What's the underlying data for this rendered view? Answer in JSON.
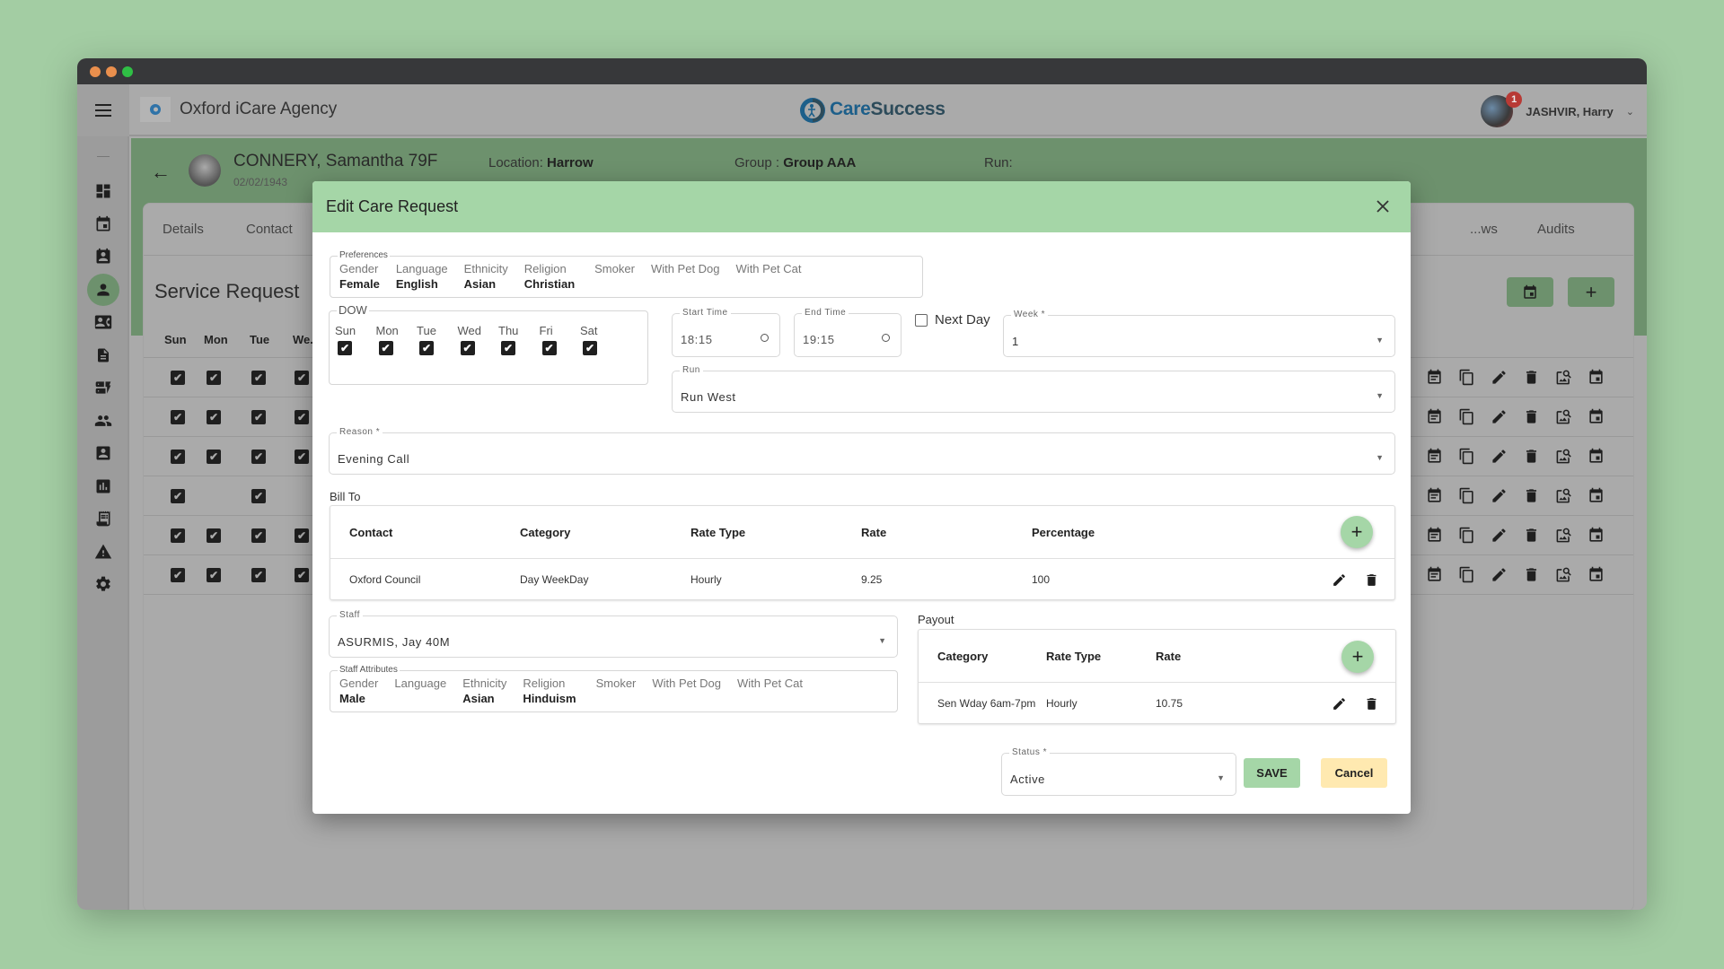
{
  "window": {
    "traffic_lights": [
      "close",
      "minimize",
      "maximize"
    ]
  },
  "header": {
    "agency_name": "Oxford iCare Agency",
    "brand_care": "Care",
    "brand_success": "Success",
    "user_name": "JASHVIR, Harry",
    "notification_count": "1"
  },
  "sidebar": {
    "items": [
      {
        "icon": "dashboard-icon"
      },
      {
        "icon": "calendar-icon"
      },
      {
        "icon": "calendar-person-icon"
      },
      {
        "icon": "person-icon",
        "active": true
      },
      {
        "icon": "contact-card-icon"
      },
      {
        "icon": "document-icon"
      },
      {
        "icon": "dynamic-form-icon"
      },
      {
        "icon": "people-icon"
      },
      {
        "icon": "account-box-icon"
      },
      {
        "icon": "chart-icon"
      },
      {
        "icon": "receipt-icon"
      },
      {
        "icon": "warning-icon"
      },
      {
        "icon": "settings-icon"
      }
    ]
  },
  "patient": {
    "name": "CONNERY, Samantha 79F",
    "dob": "02/02/1943",
    "location_label": "Location: ",
    "location": "Harrow",
    "group_label": "Group : ",
    "group": "Group AAA",
    "run_label": "Run:"
  },
  "background": {
    "tabs": [
      "Details",
      "Contact",
      "...ws",
      "Audits"
    ],
    "title": "Service Request",
    "columns": [
      "Sun",
      "Mon",
      "Tue",
      "We..."
    ],
    "rows": [
      [
        true,
        true,
        true,
        true
      ],
      [
        true,
        true,
        true,
        true
      ],
      [
        true,
        true,
        true,
        true
      ],
      [
        true,
        false,
        true,
        false
      ],
      [
        true,
        true,
        true,
        true
      ],
      [
        true,
        true,
        true,
        true
      ]
    ],
    "row_actions": [
      "event-note-icon",
      "copy-icon",
      "edit-icon",
      "delete-icon",
      "image-search-icon",
      "event-icon"
    ]
  },
  "dialog": {
    "title": "Edit Care Request",
    "preferences": {
      "legend": "Preferences",
      "attributes": [
        {
          "label": "Gender",
          "value": "Female"
        },
        {
          "label": "Language",
          "value": "English"
        },
        {
          "label": "Ethnicity",
          "value": "Asian"
        },
        {
          "label": "Religion",
          "value": "Christian"
        },
        {
          "label": "Smoker",
          "value": ""
        },
        {
          "label": "With Pet Dog",
          "value": ""
        },
        {
          "label": "With Pet Cat",
          "value": ""
        }
      ]
    },
    "dow": {
      "legend": "DOW",
      "days": [
        {
          "label": "Sun",
          "checked": true
        },
        {
          "label": "Mon",
          "checked": true
        },
        {
          "label": "Tue",
          "checked": true
        },
        {
          "label": "Wed",
          "checked": true
        },
        {
          "label": "Thu",
          "checked": true
        },
        {
          "label": "Fri",
          "checked": true
        },
        {
          "label": "Sat",
          "checked": true
        }
      ]
    },
    "start_time": {
      "label": "Start Time",
      "value": "18:15"
    },
    "end_time": {
      "label": "End Time",
      "value": "19:15"
    },
    "next_day": {
      "label": "Next Day",
      "checked": false
    },
    "week": {
      "label": "Week *",
      "value": "1"
    },
    "run": {
      "label": "Run",
      "value": "Run West"
    },
    "reason": {
      "label": "Reason *",
      "value": "Evening Call"
    },
    "bill_to": {
      "label": "Bill To",
      "columns": [
        "Contact",
        "Category",
        "Rate Type",
        "Rate",
        "Percentage"
      ],
      "rows": [
        {
          "contact": "Oxford Council",
          "category": "Day WeekDay",
          "rate_type": "Hourly",
          "rate": "9.25",
          "percentage": "100"
        }
      ]
    },
    "staff": {
      "label": "Staff",
      "value": "ASURMIS, Jay 40M"
    },
    "staff_attributes": {
      "legend": "Staff Attributes",
      "attributes": [
        {
          "label": "Gender",
          "value": "Male"
        },
        {
          "label": "Language",
          "value": ""
        },
        {
          "label": "Ethnicity",
          "value": "Asian"
        },
        {
          "label": "Religion",
          "value": "Hinduism"
        },
        {
          "label": "Smoker",
          "value": ""
        },
        {
          "label": "With Pet Dog",
          "value": ""
        },
        {
          "label": "With Pet Cat",
          "value": ""
        }
      ]
    },
    "payout": {
      "label": "Payout",
      "columns": [
        "Category",
        "Rate Type",
        "Rate"
      ],
      "rows": [
        {
          "category": "Sen Wday 6am-7pm",
          "rate_type": "Hourly",
          "rate": "10.75"
        }
      ]
    },
    "status": {
      "label": "Status *",
      "value": "Active"
    },
    "save_label": "SAVE",
    "cancel_label": "Cancel"
  },
  "colors": {
    "accent_green": "#a5d6a7",
    "cancel_yellow": "#ffe9b0",
    "badge_red": "#b83a35",
    "brand_blue": "#1d5f8a"
  }
}
